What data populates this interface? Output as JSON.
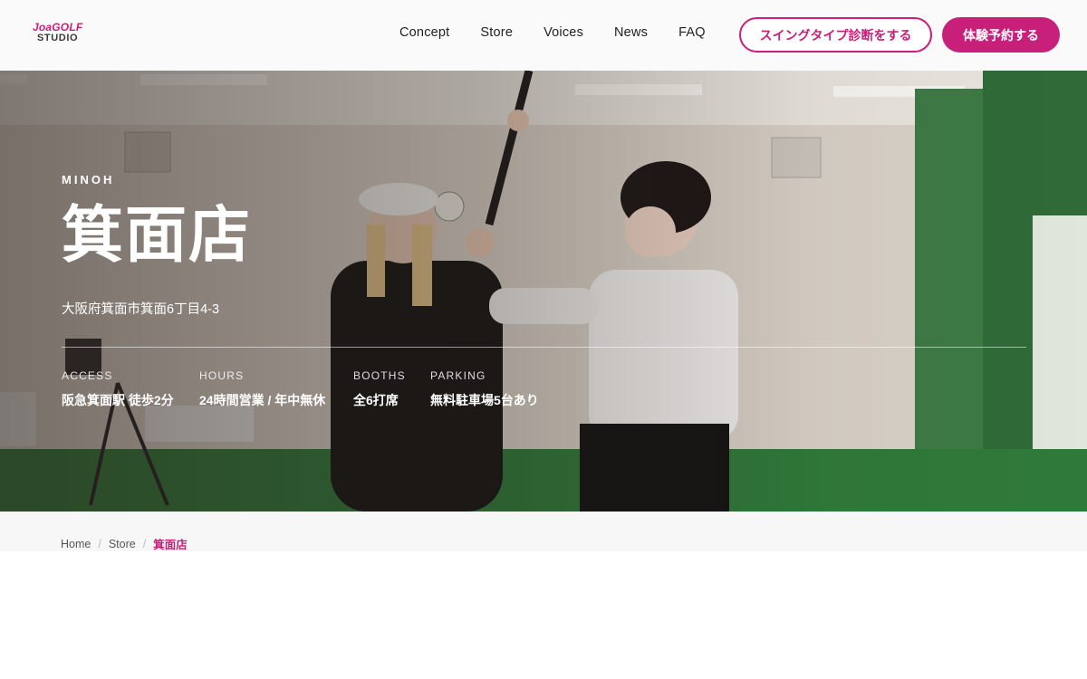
{
  "header": {
    "logo_line1": "JoaGOLF",
    "logo_line2": "STUDIO",
    "nav": [
      "Concept",
      "Store",
      "Voices",
      "News",
      "FAQ"
    ],
    "diagnose_button": "スイングタイプ診断をする",
    "reserve_button": "体験予約する"
  },
  "hero": {
    "eyebrow": "MINOH",
    "title": "箕面店",
    "address": "大阪府箕面市箕面6丁目4-3",
    "info": [
      {
        "label": "ACCESS",
        "value": "阪急箕面駅 徒歩2分"
      },
      {
        "label": "HOURS",
        "value": "24時間営業 / 年中無休"
      },
      {
        "label": "BOOTHS",
        "value": "全6打席"
      },
      {
        "label": "PARKING",
        "value": "無料駐車場5台あり"
      }
    ]
  },
  "breadcrumb": {
    "items": [
      "Home",
      "Store"
    ],
    "current": "箕面店"
  },
  "colors": {
    "brand": "#c8207a",
    "nav_text": "#222222",
    "header_bg": "#fafafa",
    "crumb_bg": "#f7f7f7"
  }
}
